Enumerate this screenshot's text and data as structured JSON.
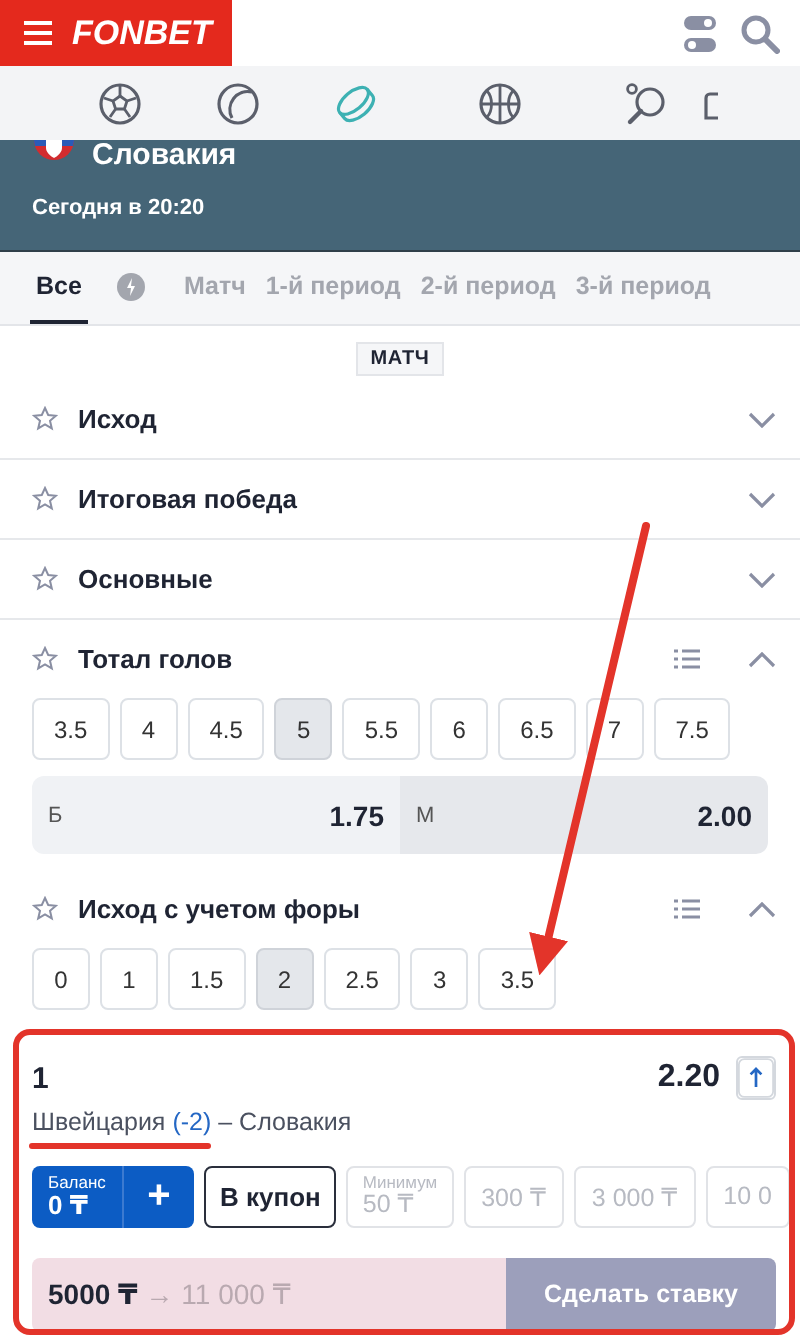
{
  "header": {
    "logo": "FONBET"
  },
  "sports": [
    {
      "kind": "soccer",
      "selected": false
    },
    {
      "kind": "tennis",
      "selected": false
    },
    {
      "kind": "hockey",
      "selected": true
    },
    {
      "kind": "basketball",
      "selected": false
    },
    {
      "kind": "table-tennis",
      "selected": false
    },
    {
      "kind": "partial",
      "selected": false
    }
  ],
  "match": {
    "team": "Словакия",
    "time": "Сегодня в 20:20"
  },
  "tabs": [
    {
      "kind": "text",
      "label": "Все",
      "selected": true
    },
    {
      "kind": "icon",
      "selected": false
    },
    {
      "kind": "text",
      "label": "Матч",
      "selected": false
    },
    {
      "kind": "text",
      "label": "1-й период",
      "selected": false
    },
    {
      "kind": "text",
      "label": "2-й период",
      "selected": false
    },
    {
      "kind": "text",
      "label": "3-й период",
      "selected": false
    }
  ],
  "section_label": "МАТЧ",
  "markets": [
    {
      "title": "Исход",
      "expanded": false
    },
    {
      "title": "Итоговая победа",
      "expanded": false
    },
    {
      "title": "Основные",
      "expanded": false
    },
    {
      "title": "Тотал голов",
      "expanded": true,
      "lines": [
        {
          "label": "3.5",
          "selected": false
        },
        {
          "label": "4",
          "selected": false
        },
        {
          "label": "4.5",
          "selected": false
        },
        {
          "label": "5",
          "selected": true
        },
        {
          "label": "5.5",
          "selected": false
        },
        {
          "label": "6",
          "selected": false
        },
        {
          "label": "6.5",
          "selected": false
        },
        {
          "label": "7",
          "selected": false
        },
        {
          "label": "7.5",
          "selected": false
        }
      ],
      "outcomes": [
        {
          "label": "Б",
          "odds": "1.75"
        },
        {
          "label": "М",
          "odds": "2.00"
        }
      ]
    },
    {
      "title": "Исход с учетом форы",
      "expanded": true,
      "lines": [
        {
          "label": "0",
          "selected": false
        },
        {
          "label": "1",
          "selected": false
        },
        {
          "label": "1.5",
          "selected": false
        },
        {
          "label": "2",
          "selected": true
        },
        {
          "label": "2.5",
          "selected": false
        },
        {
          "label": "3",
          "selected": false
        },
        {
          "label": "3.5",
          "selected": false
        }
      ]
    }
  ],
  "bet_slip": {
    "outcome": "1",
    "odds": "2.20",
    "event": {
      "home": "Швейцария",
      "handicap": "(-2)",
      "away": "– Словакия"
    },
    "balance": {
      "label": "Баланс",
      "amount": "0 ₸"
    },
    "plus": "+",
    "coupon_button": "В купон",
    "minimum": {
      "label": "Минимум",
      "amount": "50 ₸"
    },
    "quick_stakes": [
      "300 ₸",
      "3 000 ₸",
      "10 0"
    ],
    "stake": "5000 ₸",
    "payout": "→ 11 000 ₸",
    "submit": "Сделать ставку"
  }
}
